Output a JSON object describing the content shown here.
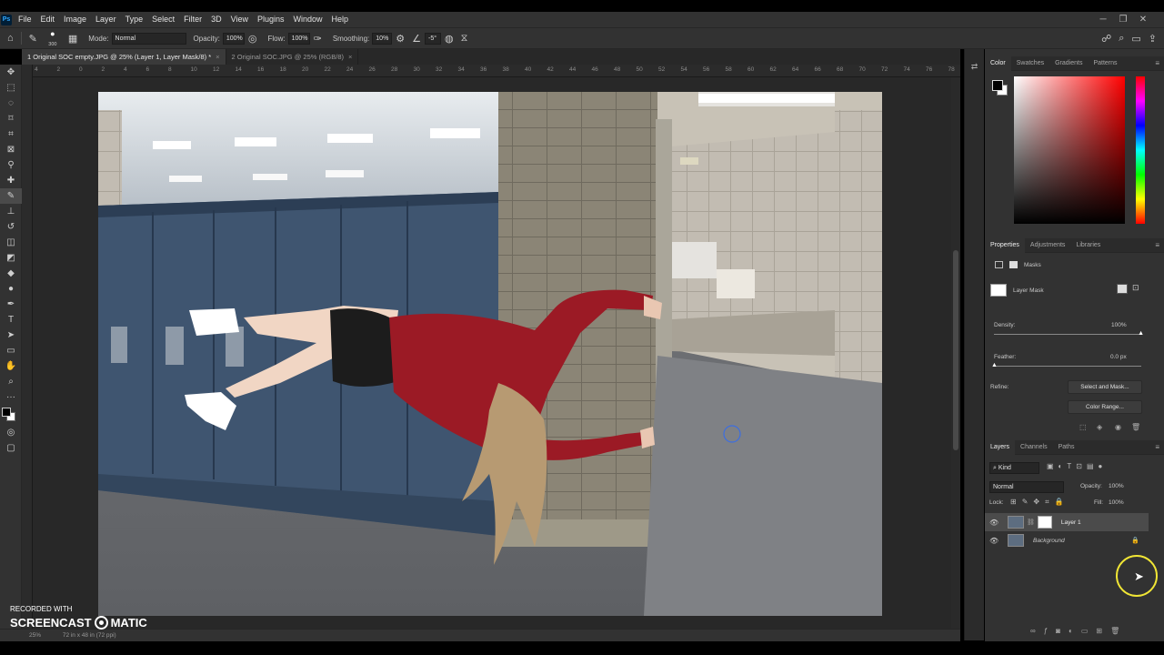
{
  "app": {
    "logo": "Ps"
  },
  "menu": [
    "File",
    "Edit",
    "Image",
    "Layer",
    "Type",
    "Select",
    "Filter",
    "3D",
    "View",
    "Plugins",
    "Window",
    "Help"
  ],
  "options": {
    "brush_size": "300",
    "mode_label": "Mode:",
    "mode_value": "Normal",
    "opacity_label": "Opacity:",
    "opacity_value": "100%",
    "flow_label": "Flow:",
    "flow_value": "100%",
    "smoothing_label": "Smoothing:",
    "smoothing_value": "10%",
    "angle_value": "-5°"
  },
  "tabs": [
    {
      "label": "1 Original SOC empty.JPG @ 25% (Layer 1, Layer Mask/8) *"
    },
    {
      "label": "2 Original SOC.JPG @ 25% (RGB/8)"
    }
  ],
  "ruler_ticks": [
    "4",
    "2",
    "0",
    "2",
    "4",
    "6",
    "8",
    "10",
    "12",
    "14",
    "16",
    "18",
    "20",
    "22",
    "24",
    "26",
    "28",
    "30",
    "32",
    "34",
    "36",
    "38",
    "40",
    "42",
    "44",
    "46",
    "48",
    "50",
    "52",
    "54",
    "56",
    "58",
    "60",
    "62",
    "64",
    "66",
    "68",
    "70",
    "72",
    "74",
    "76",
    "78"
  ],
  "status": {
    "zoom": "25%",
    "doc_size": "72 in x 48 in (72 ppi)"
  },
  "watermark": {
    "recorded": "RECORDED WITH",
    "brand_left": "SCREENCAST",
    "brand_right": "MATIC"
  },
  "color_panel": {
    "tabs": [
      "Color",
      "Swatches",
      "Gradients",
      "Patterns"
    ]
  },
  "properties": {
    "tabs": [
      "Properties",
      "Adjustments",
      "Libraries"
    ],
    "masks_label": "Masks",
    "layer_mask_label": "Layer Mask",
    "density_label": "Density:",
    "density_value": "100%",
    "feather_label": "Feather:",
    "feather_value": "0.0 px",
    "refine_label": "Refine:",
    "select_and_mask": "Select and Mask...",
    "color_range": "Color Range..."
  },
  "layers": {
    "tabs": [
      "Layers",
      "Channels",
      "Paths"
    ],
    "filter_kind": "Kind",
    "blend_mode": "Normal",
    "opacity_label": "Opacity:",
    "opacity_value": "100%",
    "lock_label": "Lock:",
    "fill_label": "Fill:",
    "fill_value": "100%",
    "items": [
      {
        "name": "Layer 1"
      },
      {
        "name": "Background"
      }
    ]
  }
}
